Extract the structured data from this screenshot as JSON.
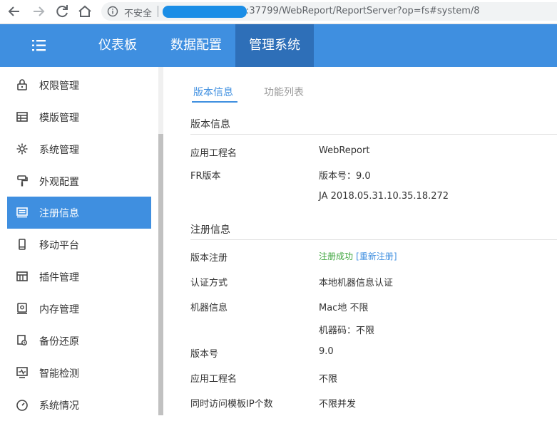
{
  "browser": {
    "insecure_label": "不安全",
    "url_path": ":37799/WebReport/ReportServer?op=fs#system/8"
  },
  "header": {
    "tabs": [
      {
        "label": "仪表板"
      },
      {
        "label": "数据配置"
      },
      {
        "label": "管理系统"
      }
    ]
  },
  "sidebar": {
    "items": [
      {
        "label": "权限管理"
      },
      {
        "label": "模版管理"
      },
      {
        "label": "系统管理"
      },
      {
        "label": "外观配置"
      },
      {
        "label": "注册信息"
      },
      {
        "label": "移动平台"
      },
      {
        "label": "插件管理"
      },
      {
        "label": "内存管理"
      },
      {
        "label": "备份还原"
      },
      {
        "label": "智能检测"
      },
      {
        "label": "系统情况"
      }
    ]
  },
  "main": {
    "tabs": [
      {
        "label": "版本信息"
      },
      {
        "label": "功能列表"
      }
    ],
    "version_section": {
      "title": "版本信息",
      "rows": [
        {
          "label": "应用工程名",
          "value": "WebReport"
        },
        {
          "label": "FR版本",
          "value": "版本号：9.0"
        },
        {
          "label": "",
          "value": "JA     2018.05.31.10.35.18.272"
        }
      ]
    },
    "register_section": {
      "title": "注册信息",
      "status": "注册成功",
      "reregister": "[重新注册]",
      "rows": [
        {
          "label": "版本注册"
        },
        {
          "label": "认证方式",
          "value": "本地机器信息认证"
        },
        {
          "label": "机器信息",
          "value": "Mac地     不限"
        },
        {
          "label": "",
          "value": "机器码：不限"
        },
        {
          "label": "版本号",
          "value": "9.0"
        },
        {
          "label": "应用工程名",
          "value": "不限"
        },
        {
          "label": "同时访问模板IP个数",
          "value": "不限并发"
        }
      ]
    }
  }
}
